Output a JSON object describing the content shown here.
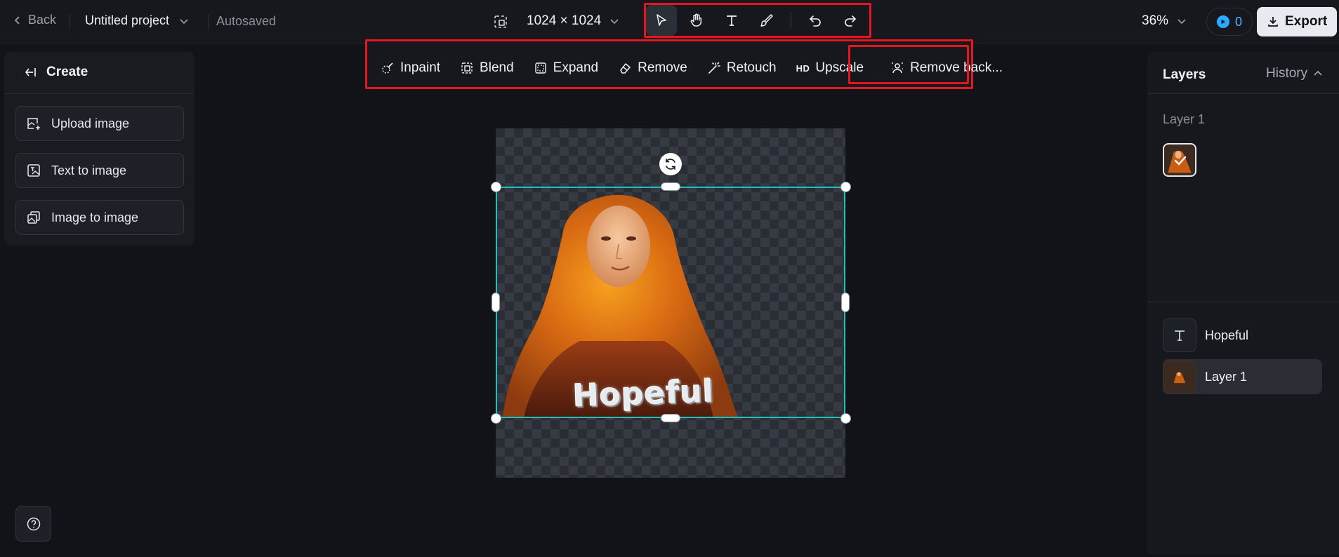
{
  "header": {
    "back_label": "Back",
    "project_name": "Untitled project",
    "save_status": "Autosaved",
    "canvas_size": "1024 × 1024",
    "zoom": "36%",
    "credits": "0",
    "export_label": "Export"
  },
  "tools": [
    {
      "name": "select-tool",
      "icon": "cursor-icon",
      "active": true
    },
    {
      "name": "hand-tool",
      "icon": "hand-icon",
      "active": false
    },
    {
      "name": "text-tool",
      "icon": "text-icon",
      "active": false
    },
    {
      "name": "brush-tool",
      "icon": "brush-icon",
      "active": false
    },
    {
      "name": "undo",
      "icon": "undo-icon",
      "active": false
    },
    {
      "name": "redo",
      "icon": "redo-icon",
      "active": false
    }
  ],
  "edit_toolbar": {
    "inpaint": "Inpaint",
    "blend": "Blend",
    "expand": "Expand",
    "remove": "Remove",
    "retouch": "Retouch",
    "upscale_badge": "HD",
    "upscale": "Upscale",
    "remove_background": "Remove back..."
  },
  "left_panel": {
    "title": "Create",
    "buttons": {
      "upload": "Upload image",
      "text_to_image": "Text to image",
      "image_to_image": "Image to image"
    }
  },
  "canvas": {
    "overlay_text": "Hopeful"
  },
  "right_panel": {
    "layers_tab": "Layers",
    "history_tab": "History",
    "group_label": "Layer 1",
    "layers": [
      {
        "name": "Hopeful",
        "type": "text"
      },
      {
        "name": "Layer 1",
        "type": "image",
        "selected": true
      }
    ]
  },
  "colors": {
    "accent_selection": "#1fc0c0",
    "highlight_red": "#e5161f",
    "credits_blue": "#29a9ff"
  }
}
